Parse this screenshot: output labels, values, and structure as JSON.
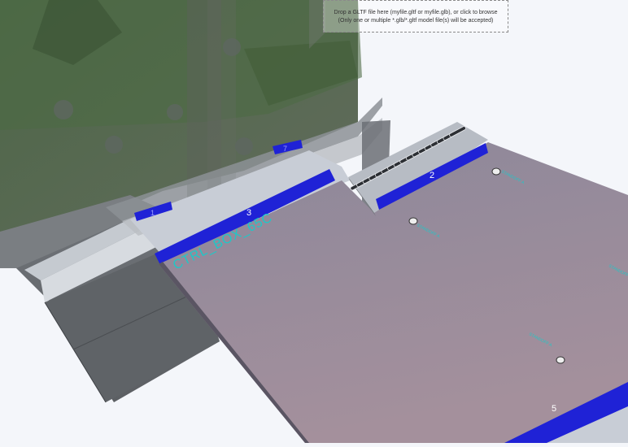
{
  "drop_zone": {
    "line1": "Drop a GLTF file here (myfile.gltf or myfile.glb), or click to browse",
    "line2": "(Only one or multiple *.glb/*.gltf model file(s) will be accepted)"
  },
  "model": {
    "part_label": "CTRL_BOX_65C",
    "standoff_label": "STANDOFF A",
    "strip_labels": [
      "1",
      "2",
      "3",
      "5",
      "7"
    ]
  },
  "colors": {
    "background": "#f4f6fa",
    "tape_blue": "#1f22d6",
    "plate": "#8f8a9c",
    "label_cyan": "#1fc7c7"
  }
}
